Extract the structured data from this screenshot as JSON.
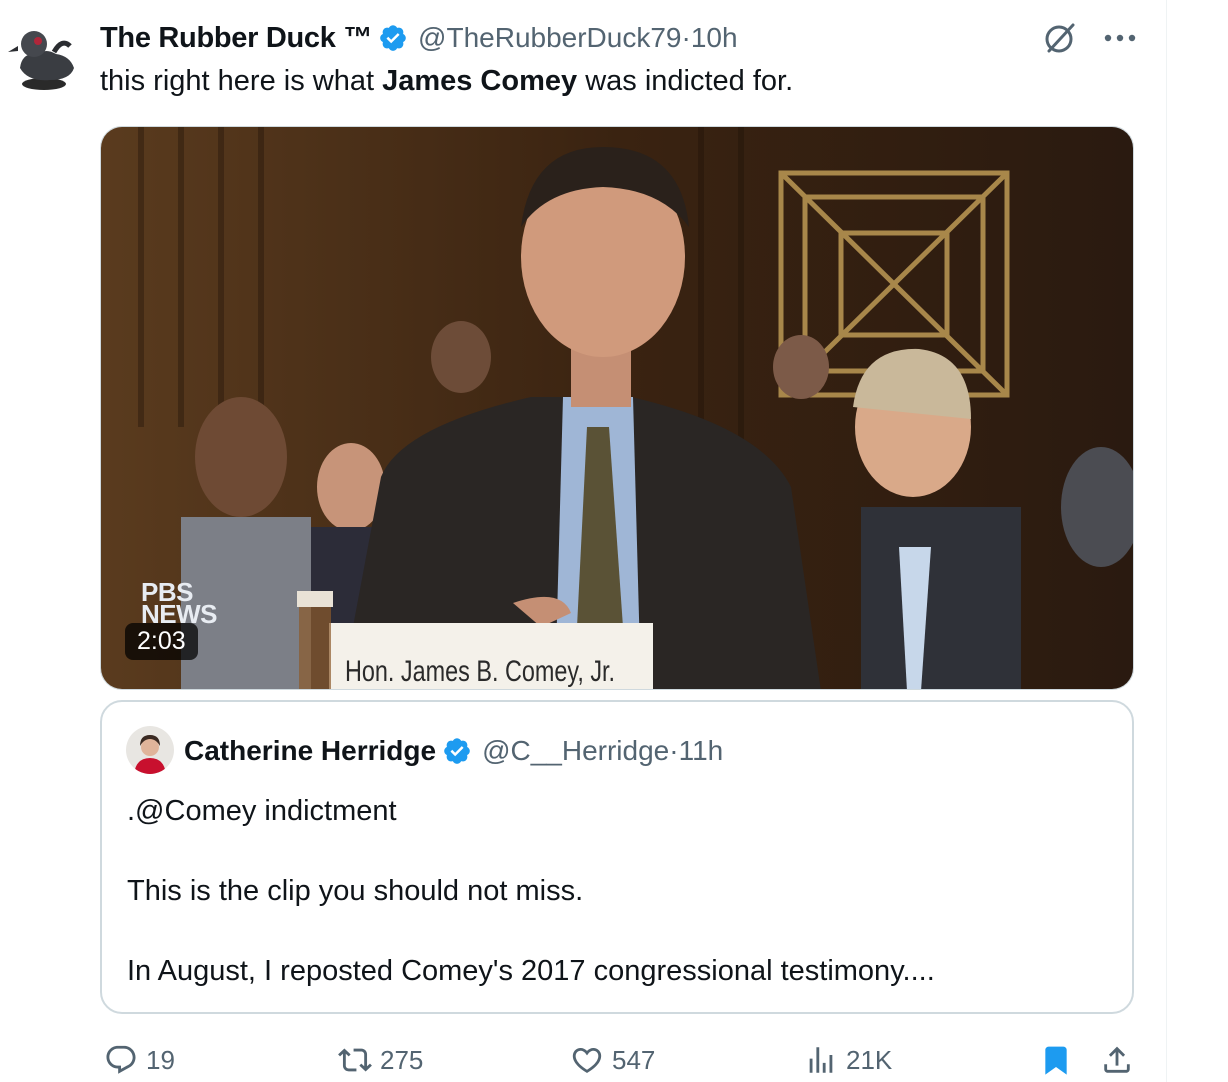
{
  "post": {
    "author_name": "The Rubber Duck ™",
    "handle": "@TheRubberDuck79",
    "separator": "·",
    "time": "10h",
    "text_before": "this right here is what ",
    "text_bold": "James Comey",
    "text_after": " was indicted for.",
    "video": {
      "duration": "2:03",
      "placard": "Hon. James B. Comey, Jr.",
      "broadcaster": "PBS NEWS"
    }
  },
  "quote": {
    "author_name": "Catherine Herridge",
    "handle": "@C__Herridge",
    "separator": "·",
    "time": "11h",
    "lines": [
      ".@Comey indictment",
      "This is the clip you should not miss.",
      "In August, I reposted Comey's 2017 congressional testimony...."
    ]
  },
  "actions": {
    "replies": "19",
    "reposts": "275",
    "likes": "547",
    "views": "21K"
  },
  "colors": {
    "verified": "#1d9bf0",
    "bookmark_active": "#1d9bf0",
    "secondary_text": "#536471",
    "border": "#cfd9de"
  },
  "icons": [
    "reply-icon",
    "repost-icon",
    "like-icon",
    "views-icon",
    "bookmark-icon",
    "share-icon",
    "grok-icon",
    "more-icon",
    "verified-icon"
  ]
}
